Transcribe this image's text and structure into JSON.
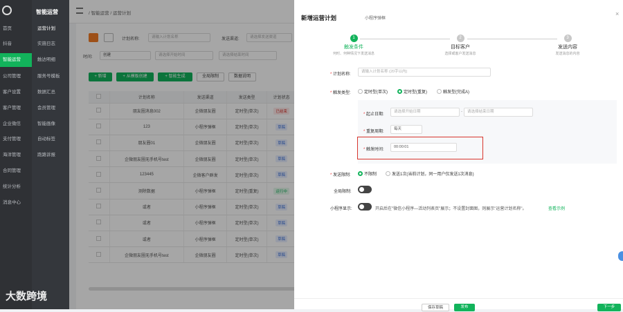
{
  "brand": "智能运营",
  "watermark": "大数跨境",
  "nav1": [
    "首页",
    "抖音",
    "智能运营",
    "公司管理",
    "客户设置",
    "客户管理",
    "企业微信",
    "支付管理",
    "海洋管理",
    "合同管理",
    "统计分析",
    "消息中心"
  ],
  "nav2": [
    "运营计划",
    "实施日志",
    "触达明细",
    "服务号模板",
    "数据汇总",
    "会员管理",
    "智能画像",
    "自动标签",
    "跑路诉报"
  ],
  "breadcrumb": "/ 智能运营 / 运营计划",
  "filters": {
    "plan_name_label": "计划名称:",
    "plan_name_ph": "请输入计划名称",
    "channel_label": "发送渠道:",
    "channel_ph": "请选择发送渠道",
    "time_label": "时间:",
    "time_value": "创建",
    "start_ph": "请选择开始时间",
    "end_ph": "请选择结束时间"
  },
  "buttons": {
    "add": "+ 新增",
    "from_template": "+ 从模板创建",
    "smart": "+ 智能生成",
    "global_limit": "全局限制",
    "data_desc": "数据说明"
  },
  "table": {
    "headers": [
      "",
      "计划名称",
      "发送渠道",
      "发送类型",
      "计划状态"
    ],
    "rows": [
      {
        "name": "朋友圈消息002",
        "channel": "企微朋友圈",
        "type": "定时型(单次)",
        "status": "已结束"
      },
      {
        "name": "123",
        "channel": "小程序弹框",
        "type": "定时型(单次)",
        "status": "草稿"
      },
      {
        "name": "朋友圈01",
        "channel": "企微朋友圈",
        "type": "定时型(单次)",
        "status": "草稿"
      },
      {
        "name": "企微朋友圈无手机号test",
        "channel": "企微朋友圈",
        "type": "定时型(单次)",
        "status": "草稿"
      },
      {
        "name": "123445",
        "channel": "企微客户群发",
        "type": "定时型(单次)",
        "status": "草稿"
      },
      {
        "name": "测除数据",
        "channel": "小程序弹框",
        "type": "定时型(重复)",
        "status": "运行中"
      },
      {
        "name": "或者",
        "channel": "小程序弹框",
        "type": "定时型(单次)",
        "status": "草稿"
      },
      {
        "name": "或者",
        "channel": "小程序弹框",
        "type": "定时型(单次)",
        "status": "草稿"
      },
      {
        "name": "或者",
        "channel": "小程序弹框",
        "type": "定时型(单次)",
        "status": "草稿"
      },
      {
        "name": "企微朋友圈无手机号test",
        "channel": "企微朋友圈",
        "type": "定时型(单次)",
        "status": "草稿"
      }
    ]
  },
  "drawer": {
    "title": "新增运营计划",
    "subtitle": "小程序弹框",
    "steps": [
      {
        "num": "1",
        "label": "触发条件",
        "desc": "何时、何种情况下发送消息"
      },
      {
        "num": "2",
        "label": "目标客户",
        "desc": "选择或客户发送消息"
      },
      {
        "num": "3",
        "label": "发送内容",
        "desc": "发送消息的内容"
      }
    ],
    "plan_name_label": "计划名称:",
    "plan_name_ph": "请输入计划名称 (20字以内)",
    "trigger_type_label": "触发类型:",
    "trigger_opts": [
      "定时型(单次)",
      "定时型(重复)",
      "触发型(完成A)"
    ],
    "date_label": "起止日期:",
    "date_start_ph": "请选择开始日期",
    "date_end_ph": "请选择结束日期",
    "repeat_label": "重复周期:",
    "repeat_value": "每天",
    "trigger_time_label": "触发时间:",
    "trigger_time_value": "00:00:01",
    "send_limit_label": "发送限制:",
    "send_limit_opts": [
      "不限制",
      "发送1次(当前计划，同一用户仅发送1次消息)"
    ],
    "global_limit_label": "全局限制:",
    "mp_show_label": "小程序显示:",
    "mp_show_text": "开启后在\"微信小程序—活动列表页\"展示；不设置封面图，则展示\"运营计划名称\"。",
    "mp_show_link": "查看示例",
    "footer_save": "保存草稿",
    "footer_publish": "发布",
    "footer_next": "下一步"
  },
  "colors": {
    "accent": "#12b35b",
    "danger": "#d8342c",
    "orange": "#f27b25"
  }
}
